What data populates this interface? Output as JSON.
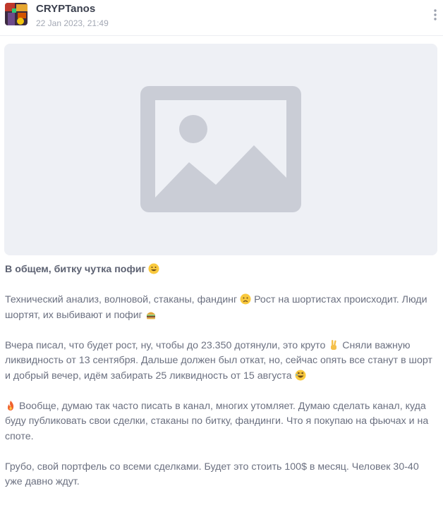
{
  "post": {
    "channel_name": "CRYPTanos",
    "date": "22 Jan 2023, 21:49",
    "media_icon": "image-placeholder-icon",
    "headline": "В общем, битку чутка пофиг",
    "paragraphs": [
      {
        "text_1": "Технический анализ, волновой, стаканы, фандинг",
        "text_2": "Рост на шортистах происходит. Люди шортят, их выбивают и пофиг"
      },
      {
        "text_1": "Вчера писал, что будет рост, ну, чтобы до 23.350 дотянули, это круто",
        "text_2": "Сняли важную ликвидность от 13 сентября. Дальше должен был откат, но, сейчас опять все станут в шорт и добрый вечер, идём забирать 25 ликвидность от 15 августа"
      },
      {
        "text_1": "Вообще, думаю так часто писать в канал, многих утомляет. Думаю сделать канал, куда буду публиковать свои сделки, стаканы по битку, фандинги. Что я покупаю на фьючах и на споте."
      },
      {
        "text_1": "Грубо, свой портфель со всеми сделками. Будет это стоить 100$ в месяц. Человек 30-40 уже давно ждут."
      }
    ],
    "emoji_names": [
      "grinning-face-icon",
      "frowning-face-icon",
      "burger-icon",
      "victory-hand-icon",
      "laughing-face-icon",
      "fire-icon"
    ]
  },
  "colors": {
    "text": "#6b7080",
    "headline": "#5d6272",
    "placeholder_bg": "#eef0f5",
    "placeholder_icon": "#cacdd6"
  }
}
